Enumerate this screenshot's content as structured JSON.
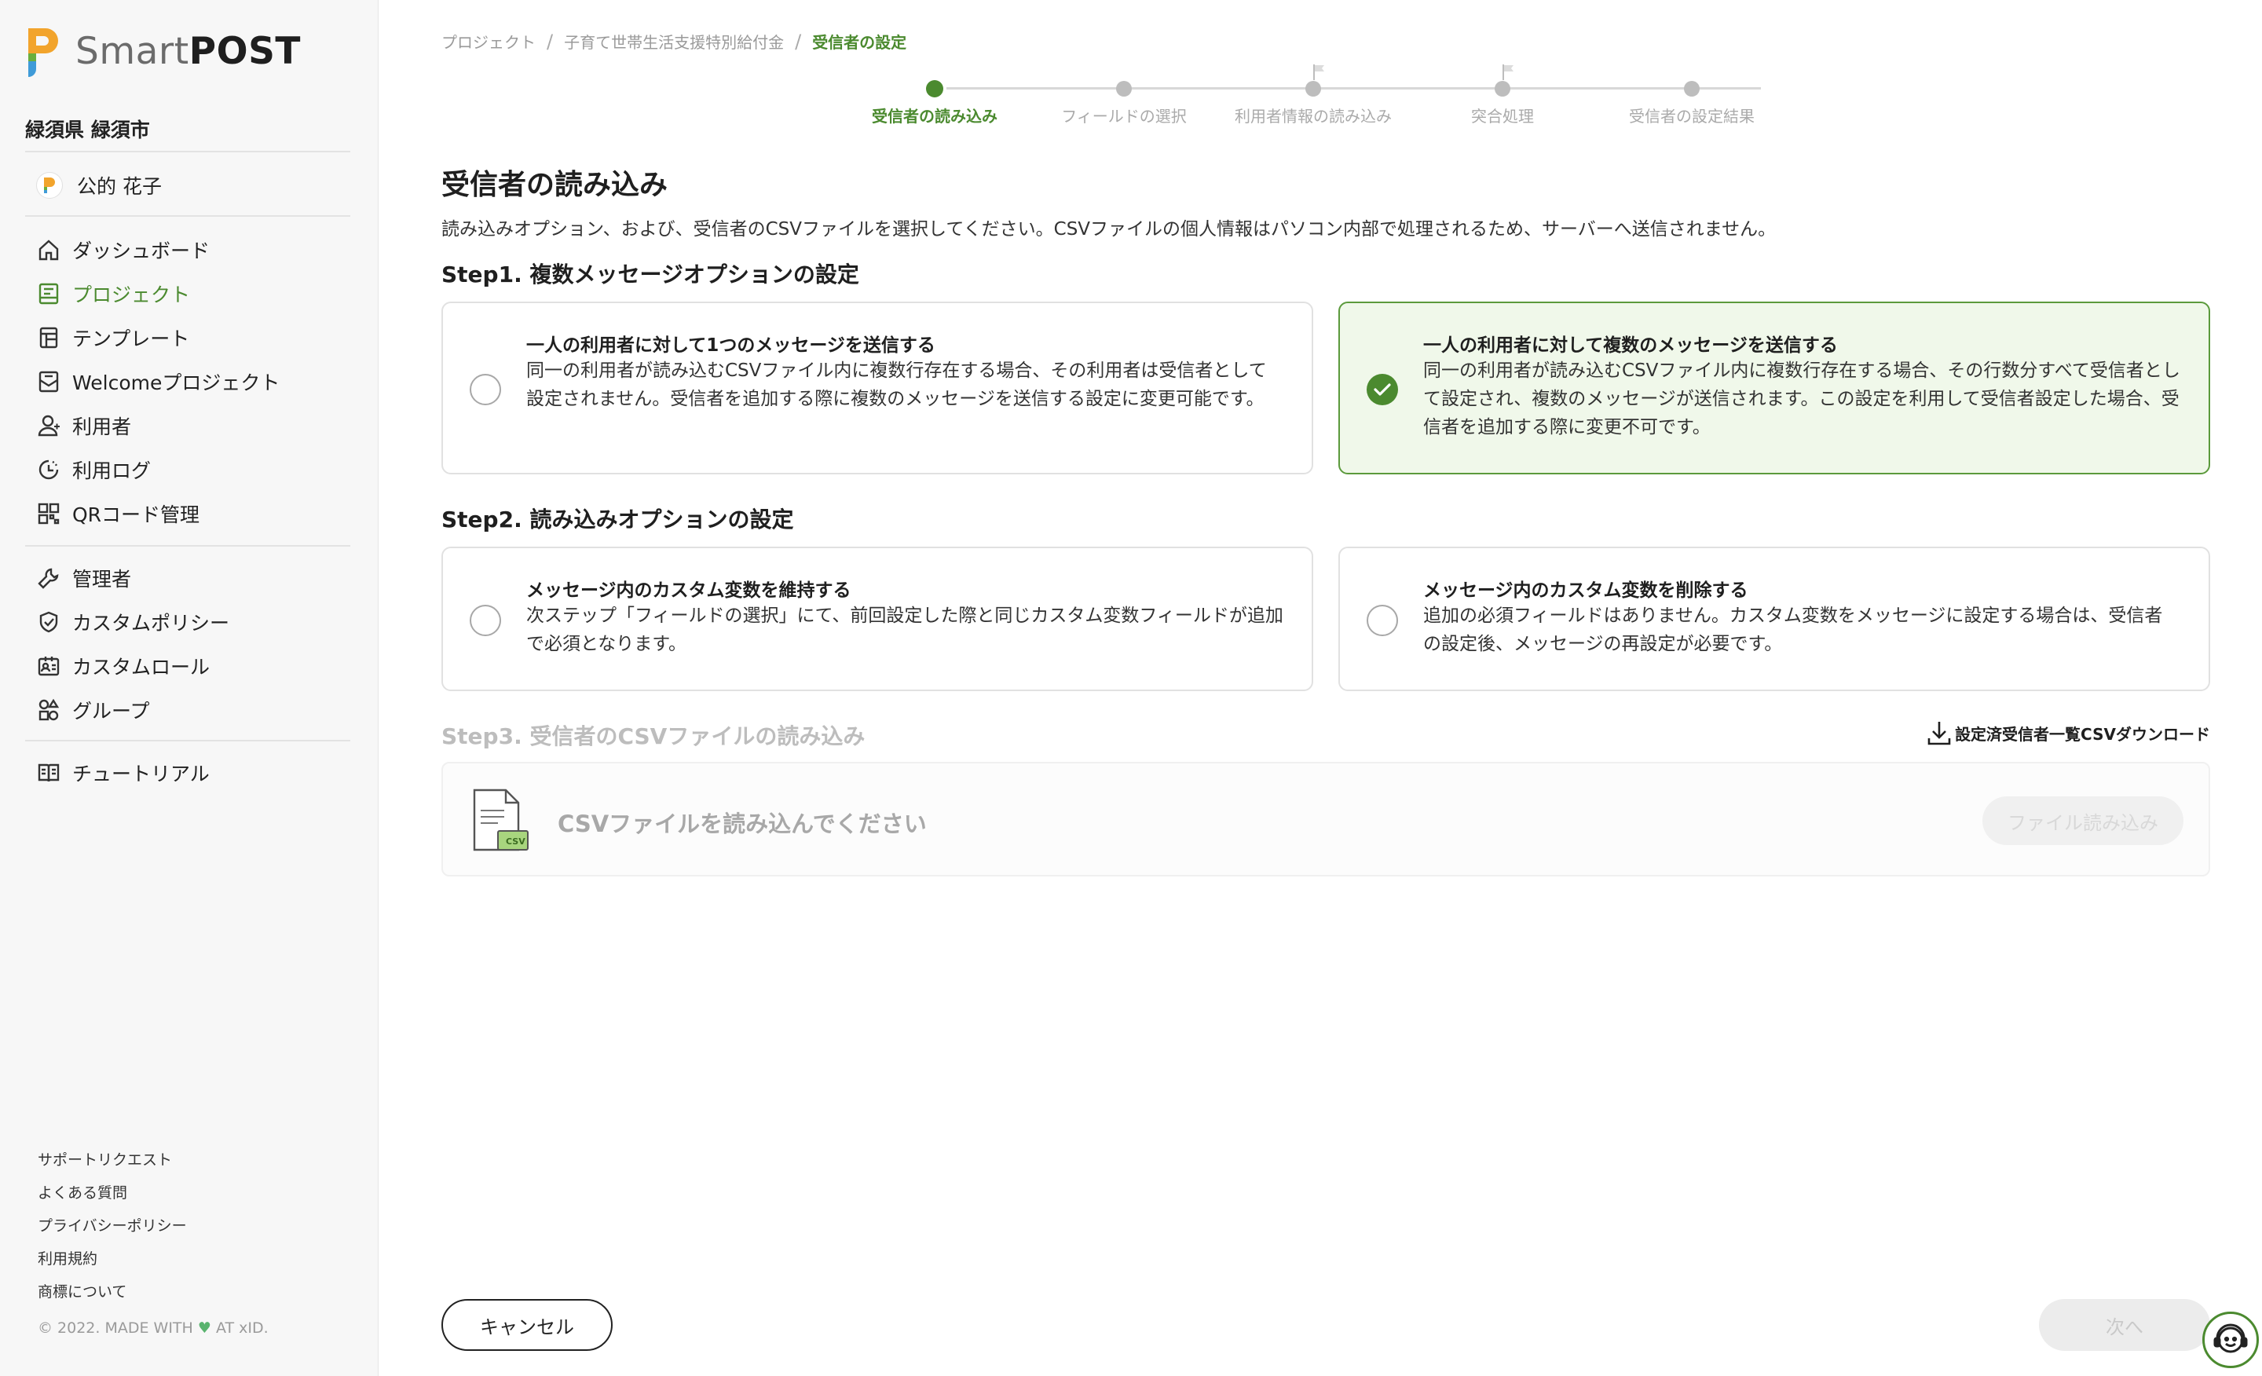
{
  "brand": {
    "name_light": "Smart",
    "name_bold": "POST",
    "accent": "#4b8a2f",
    "logo_orange": "#f2a42c",
    "logo_green": "#6aaf3d",
    "logo_blue": "#3f9bd8"
  },
  "sidebar": {
    "org_name": "緑須県 緑須市",
    "user_name": "公的 花子",
    "nav_primary": [
      {
        "label": "ダッシュボード",
        "icon": "home-icon"
      },
      {
        "label": "プロジェクト",
        "icon": "project-icon",
        "active": true
      },
      {
        "label": "テンプレート",
        "icon": "template-icon"
      },
      {
        "label": "Welcomeプロジェクト",
        "icon": "welcome-icon"
      },
      {
        "label": "利用者",
        "icon": "user-icon"
      },
      {
        "label": "利用ログ",
        "icon": "log-icon"
      },
      {
        "label": "QRコード管理",
        "icon": "qr-icon"
      }
    ],
    "nav_admin": [
      {
        "label": "管理者",
        "icon": "wrench-icon"
      },
      {
        "label": "カスタムポリシー",
        "icon": "shield-icon"
      },
      {
        "label": "カスタムロール",
        "icon": "id-card-icon"
      },
      {
        "label": "グループ",
        "icon": "group-icon"
      }
    ],
    "nav_help": [
      {
        "label": "チュートリアル",
        "icon": "book-icon"
      }
    ],
    "footer_links": [
      "サポートリクエスト",
      "よくある質問",
      "プライバシーポリシー",
      "利用規約",
      "商標について"
    ],
    "copyright_pre": "© 2022. MADE WITH",
    "copyright_post": "AT xID."
  },
  "breadcrumb": [
    "プロジェクト",
    "子育て世帯生活支援特別給付金",
    "受信者の設定"
  ],
  "stepper": [
    {
      "label": "受信者の読み込み",
      "state": "active"
    },
    {
      "label": "フィールドの選択",
      "state": "pending"
    },
    {
      "label": "利用者情報の読み込み",
      "state": "pending",
      "flag": true
    },
    {
      "label": "突合処理",
      "state": "pending",
      "flag": true
    },
    {
      "label": "受信者の設定結果",
      "state": "pending"
    }
  ],
  "page": {
    "title": "受信者の読み込み",
    "description": "読み込みオプション、および、受信者のCSVファイルを選択してください。CSVファイルの個人情報はパソコン内部で処理されるため、サーバーへ送信されません。"
  },
  "step1": {
    "title": "Step1. 複数メッセージオプションの設定",
    "options": [
      {
        "title": "一人の利用者に対して1つのメッセージを送信する",
        "desc": "同一の利用者が読み込むCSVファイル内に複数行存在する場合、その利用者は受信者として設定されません。受信者を追加する際に複数のメッセージを送信する設定に変更可能です。",
        "selected": false
      },
      {
        "title": "一人の利用者に対して複数のメッセージを送信する",
        "desc": "同一の利用者が読み込むCSVファイル内に複数行存在する場合、その行数分すべて受信者として設定され、複数のメッセージが送信されます。この設定を利用して受信者設定した場合、受信者を追加する際に変更不可です。",
        "selected": true
      }
    ]
  },
  "step2": {
    "title": "Step2. 読み込みオプションの設定",
    "options": [
      {
        "title": "メッセージ内のカスタム変数を維持する",
        "desc": "次ステップ「フィールドの選択」にて、前回設定した際と同じカスタム変数フィールドが追加で必須となります。",
        "selected": false
      },
      {
        "title": "メッセージ内のカスタム変数を削除する",
        "desc": "追加の必須フィールドはありません。カスタム変数をメッセージに設定する場合は、受信者の設定後、メッセージの再設定が必要です。",
        "selected": false
      }
    ]
  },
  "step3": {
    "title": "Step3. 受信者のCSVファイルの読み込み",
    "download_label": "設定済受信者一覧CSVダウンロード",
    "upload_prompt": "CSVファイルを読み込んでください",
    "upload_button": "ファイル読み込み",
    "csv_badge": "CSV"
  },
  "actions": {
    "cancel": "キャンセル",
    "next": "次へ"
  }
}
